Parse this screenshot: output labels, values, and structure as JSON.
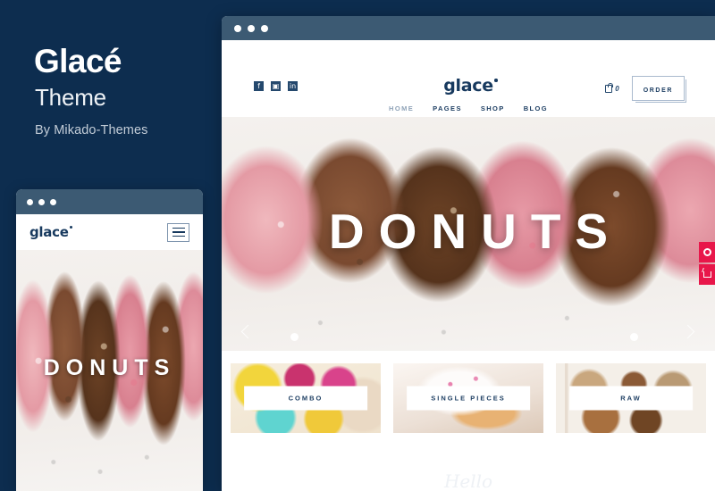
{
  "promo": {
    "title": "Glacé",
    "subtitle": "Theme",
    "author": "By Mikado-Themes"
  },
  "colors": {
    "background": "#0d2d4f",
    "chrome": "#3c5a73",
    "navy_text": "#1e3f63",
    "accent_pink": "#e8174a"
  },
  "browser": {
    "traffic_dots": [
      "dot",
      "dot",
      "dot"
    ]
  },
  "site": {
    "logo": "glace",
    "social": [
      {
        "name": "facebook-icon",
        "glyph": "f"
      },
      {
        "name": "instagram-icon",
        "glyph": "▣"
      },
      {
        "name": "linkedin-icon",
        "glyph": "in"
      }
    ],
    "nav": [
      {
        "label": "HOME",
        "active": true
      },
      {
        "label": "PAGES",
        "active": false
      },
      {
        "label": "SHOP",
        "active": false
      },
      {
        "label": "BLOG",
        "active": false
      }
    ],
    "cart_count": "0",
    "order_button": "ORDER",
    "side_widgets": [
      {
        "name": "search-widget-icon"
      },
      {
        "name": "cart-widget-icon"
      }
    ]
  },
  "hero": {
    "title": "DONUTS",
    "prev_label": "‹",
    "next_label": "›",
    "dots": 2
  },
  "categories": [
    {
      "label": "COMBO",
      "photo": "ph-combo"
    },
    {
      "label": "SINGLE PIECES",
      "photo": "ph-single"
    },
    {
      "label": "RAW",
      "photo": "ph-raw"
    }
  ],
  "footer": {
    "script_text": "Hello"
  },
  "mobile": {
    "logo": "glace",
    "hero_title": "DONUTS"
  }
}
